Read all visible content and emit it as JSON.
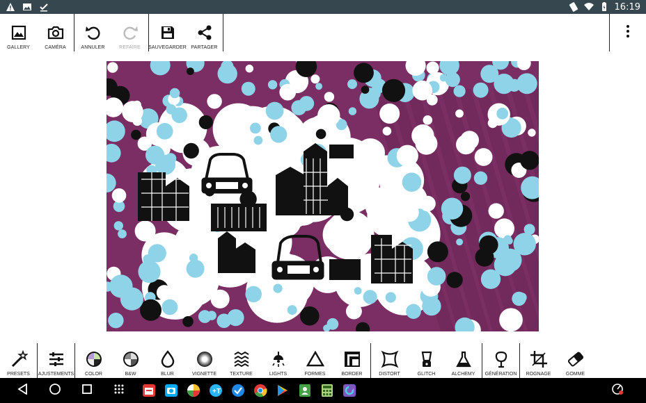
{
  "status_bar": {
    "time": "16:19",
    "left_icons": [
      "warning-icon",
      "image-icon",
      "check-icon"
    ],
    "right_icons": [
      "rotate-icon",
      "wifi-icon",
      "battery-icon"
    ]
  },
  "toolbar": {
    "gallery": "GALLERY",
    "camera": "CAMÉRA",
    "undo": "ANNULER",
    "redo": "REFAIRE",
    "save": "SAUVEGARDER",
    "share": "PARTAGER"
  },
  "tools": {
    "presets": "PRESETS",
    "adjustments": "AJUSTEMENTS",
    "color": "COLOR",
    "bw": "B&W",
    "blur": "BLUR",
    "vignette": "VIGNETTE",
    "texture": "TEXTURE",
    "lights": "LIGHTS",
    "shapes": "FORMES",
    "border": "BORDER",
    "distort": "DISTORT",
    "glitch": "GLITCH",
    "alchemy": "ALCHEMY",
    "generation": "GÉNÉRATION",
    "crop": "ROGNAGE",
    "eraser": "GOMME"
  },
  "colors": {
    "status_bar": "#37474f",
    "canvas_bg": "#7b2e63",
    "bubble": "#8fd3e8",
    "nav_bar": "#000000"
  },
  "dock_apps": [
    "calendar-app-icon",
    "camera-app-icon",
    "gallery-app-icon",
    "translate-app-icon",
    "tasks-app-icon",
    "chrome-app-icon",
    "play-store-app-icon",
    "contacts-app-icon",
    "calculator-app-icon",
    "photo-editor-app-icon"
  ]
}
